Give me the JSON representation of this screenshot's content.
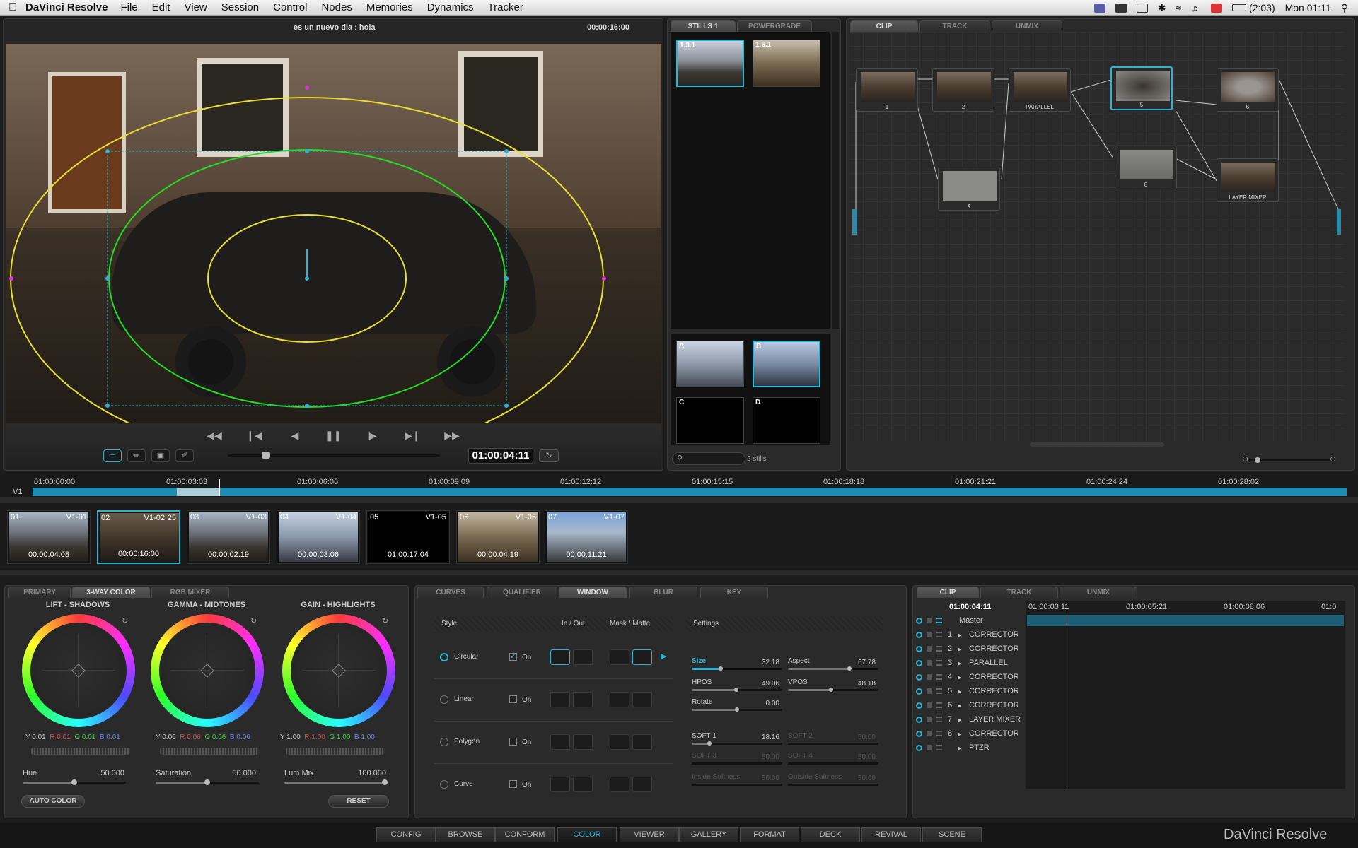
{
  "menubar": {
    "app": "DaVinci Resolve",
    "items": [
      "File",
      "Edit",
      "View",
      "Session",
      "Control",
      "Nodes",
      "Memories",
      "Dynamics",
      "Tracker"
    ],
    "battery": "(2:03)",
    "clock": "Mon 01:11"
  },
  "viewer": {
    "title": "es un nuevo dia : hola",
    "timecode": "00:00:16:00",
    "current_tc": "01:00:04:11"
  },
  "stills": {
    "tabs": [
      "STILLS 1",
      "POWERGRADE"
    ],
    "items": [
      "1.3.1",
      "1.6.1"
    ],
    "memories": [
      "A",
      "B",
      "C",
      "D"
    ],
    "count": "2 stills"
  },
  "nodegraph": {
    "tabs": [
      "CLIP",
      "TRACK",
      "UNMIX"
    ],
    "nodes": [
      "1",
      "2",
      "PARALLEL",
      "5",
      "6",
      "4",
      "8",
      "LAYER MIXER"
    ]
  },
  "timeline": {
    "track": "V1",
    "ruler": [
      "01:00:00:00",
      "01:00:03:03",
      "01:00:06:06",
      "01:00:09:09",
      "01:00:12:12",
      "01:00:15:15",
      "01:00:18:18",
      "01:00:21:21",
      "01:00:24:24",
      "01:00:28:02"
    ],
    "clips": [
      {
        "num": "01",
        "name": "V1-01",
        "dur": "00:00:04:08"
      },
      {
        "num": "02",
        "name": "V1-02",
        "dur": "00:00:16:00",
        "extra": "25"
      },
      {
        "num": "03",
        "name": "V1-03",
        "dur": "00:00:02:19"
      },
      {
        "num": "04",
        "name": "V1-04",
        "dur": "00:00:03:06"
      },
      {
        "num": "05",
        "name": "V1-05",
        "dur": "01:00:17:04"
      },
      {
        "num": "06",
        "name": "V1-06",
        "dur": "00:00:04:19"
      },
      {
        "num": "07",
        "name": "V1-07",
        "dur": "00:00:11:21"
      }
    ]
  },
  "color": {
    "tabs": [
      "PRIMARY",
      "3-WAY COLOR",
      "RGB MIXER"
    ],
    "wheels": [
      {
        "title": "LIFT - SHADOWS",
        "y": "Y 0.01",
        "r": "R 0.01",
        "g": "G 0.01",
        "b": "B 0.01"
      },
      {
        "title": "GAMMA - MIDTONES",
        "y": "Y 0.06",
        "r": "R 0.06",
        "g": "G 0.06",
        "b": "B 0.06"
      },
      {
        "title": "GAIN - HIGHLIGHTS",
        "y": "Y 1.00",
        "r": "R 1.00",
        "g": "G 1.00",
        "b": "B 1.00"
      }
    ],
    "hue_label": "Hue",
    "hue": "50.000",
    "sat_label": "Saturation",
    "sat": "50.000",
    "lum_label": "Lum Mix",
    "lum": "100.000",
    "auto": "AUTO COLOR",
    "reset": "RESET"
  },
  "window": {
    "tabs": [
      "CURVES",
      "QUALIFIER",
      "WINDOW",
      "BLUR",
      "KEY"
    ],
    "h_style": "Style",
    "h_inout": "In / Out",
    "h_mask": "Mask / Matte",
    "h_settings": "Settings",
    "rows": [
      "Circular",
      "Linear",
      "Polygon",
      "Curve"
    ],
    "on": "On",
    "size_l": "Size",
    "size": "32.18",
    "aspect_l": "Aspect",
    "aspect": "67.78",
    "hpos_l": "HPOS",
    "hpos": "49.06",
    "vpos_l": "VPOS",
    "vpos": "48.18",
    "rotate_l": "Rotate",
    "rotate": "0.00",
    "soft1_l": "SOFT 1",
    "soft1": "18.16",
    "soft2_l": "SOFT 2",
    "soft2": "50.00",
    "soft3_l": "SOFT 3",
    "soft3": "50.00",
    "soft4_l": "SOFT 4",
    "soft4": "50.00",
    "inside_l": "Inside Softness",
    "inside": "50.00",
    "outside_l": "Outside Softness",
    "outside": "50.00"
  },
  "nodelist": {
    "tabs": [
      "CLIP",
      "TRACK",
      "UNMIX"
    ],
    "tc": "01:00:04:11",
    "ruler": [
      "01:00:03:11",
      "01:00:05:21",
      "01:00:08:06",
      "01:0"
    ],
    "master": "Master",
    "rows": [
      {
        "n": "1",
        "name": "CORRECTOR"
      },
      {
        "n": "2",
        "name": "CORRECTOR"
      },
      {
        "n": "3",
        "name": "PARALLEL"
      },
      {
        "n": "4",
        "name": "CORRECTOR"
      },
      {
        "n": "5",
        "name": "CORRECTOR"
      },
      {
        "n": "6",
        "name": "CORRECTOR"
      },
      {
        "n": "7",
        "name": "LAYER MIXER"
      },
      {
        "n": "8",
        "name": "CORRECTOR"
      },
      {
        "n": "",
        "name": "PTZR"
      }
    ]
  },
  "nav": [
    "CONFIG",
    "BROWSE",
    "CONFORM",
    "COLOR",
    "VIEWER",
    "GALLERY",
    "FORMAT",
    "DECK",
    "REVIVAL",
    "SCENE"
  ],
  "brand": "DaVinci Resolve",
  "colors": {
    "accent": "#2ab5d4",
    "window_yellow": "#e8e030",
    "window_green": "#22dd22"
  }
}
